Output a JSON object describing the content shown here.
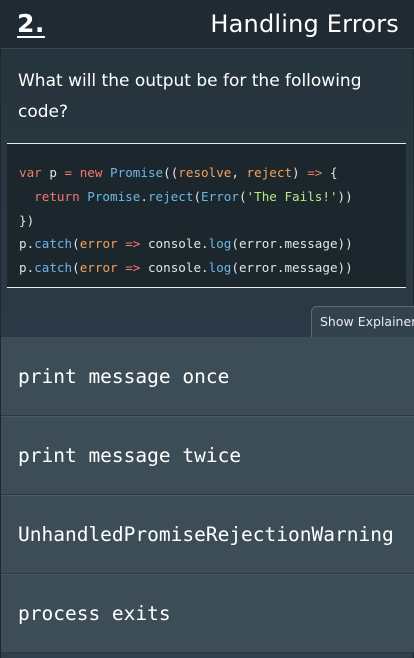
{
  "header": {
    "question_number": "2.",
    "title": "Handling Errors"
  },
  "question": {
    "text": "What will the output be for the following code?"
  },
  "code": {
    "lines": [
      [
        {
          "t": "var",
          "c": "kw"
        },
        {
          "t": " p ",
          "c": "plain"
        },
        {
          "t": "=",
          "c": "kw"
        },
        {
          "t": " ",
          "c": "plain"
        },
        {
          "t": "new",
          "c": "kw"
        },
        {
          "t": " ",
          "c": "plain"
        },
        {
          "t": "Promise",
          "c": "fn"
        },
        {
          "t": "((",
          "c": "plain"
        },
        {
          "t": "resolve",
          "c": "param"
        },
        {
          "t": ", ",
          "c": "plain"
        },
        {
          "t": "reject",
          "c": "param"
        },
        {
          "t": ") ",
          "c": "plain"
        },
        {
          "t": "=>",
          "c": "kw"
        },
        {
          "t": " {",
          "c": "plain"
        }
      ],
      [
        {
          "t": "  ",
          "c": "plain"
        },
        {
          "t": "return",
          "c": "kw"
        },
        {
          "t": " ",
          "c": "plain"
        },
        {
          "t": "Promise",
          "c": "fn"
        },
        {
          "t": ".",
          "c": "plain"
        },
        {
          "t": "reject",
          "c": "fn"
        },
        {
          "t": "(",
          "c": "plain"
        },
        {
          "t": "Error",
          "c": "fn"
        },
        {
          "t": "(",
          "c": "plain"
        },
        {
          "t": "'The Fails!'",
          "c": "str"
        },
        {
          "t": "))",
          "c": "plain"
        }
      ],
      [
        {
          "t": "})",
          "c": "plain"
        }
      ],
      [
        {
          "t": "p",
          "c": "plain"
        },
        {
          "t": ".",
          "c": "plain"
        },
        {
          "t": "catch",
          "c": "fn"
        },
        {
          "t": "(",
          "c": "plain"
        },
        {
          "t": "error",
          "c": "param"
        },
        {
          "t": " ",
          "c": "plain"
        },
        {
          "t": "=>",
          "c": "kw"
        },
        {
          "t": " console.",
          "c": "plain"
        },
        {
          "t": "log",
          "c": "fn"
        },
        {
          "t": "(error.message))",
          "c": "plain"
        }
      ],
      [
        {
          "t": "p",
          "c": "plain"
        },
        {
          "t": ".",
          "c": "plain"
        },
        {
          "t": "catch",
          "c": "fn"
        },
        {
          "t": "(",
          "c": "plain"
        },
        {
          "t": "error",
          "c": "param"
        },
        {
          "t": " ",
          "c": "plain"
        },
        {
          "t": "=>",
          "c": "kw"
        },
        {
          "t": " console.",
          "c": "plain"
        },
        {
          "t": "log",
          "c": "fn"
        },
        {
          "t": "(error.message))",
          "c": "plain"
        }
      ]
    ]
  },
  "explainer_button": {
    "label": "Show Explainer"
  },
  "answers": [
    {
      "label": "print message once"
    },
    {
      "label": "print message twice"
    },
    {
      "label": "UnhandledPromiseRejectionWarning"
    },
    {
      "label": "process exits"
    }
  ],
  "colors": {
    "keyword": "#f07b6e",
    "function": "#6ab8e6",
    "parameter": "#f6a25b",
    "string": "#b8e986",
    "answer_background": "#3d4d58"
  }
}
